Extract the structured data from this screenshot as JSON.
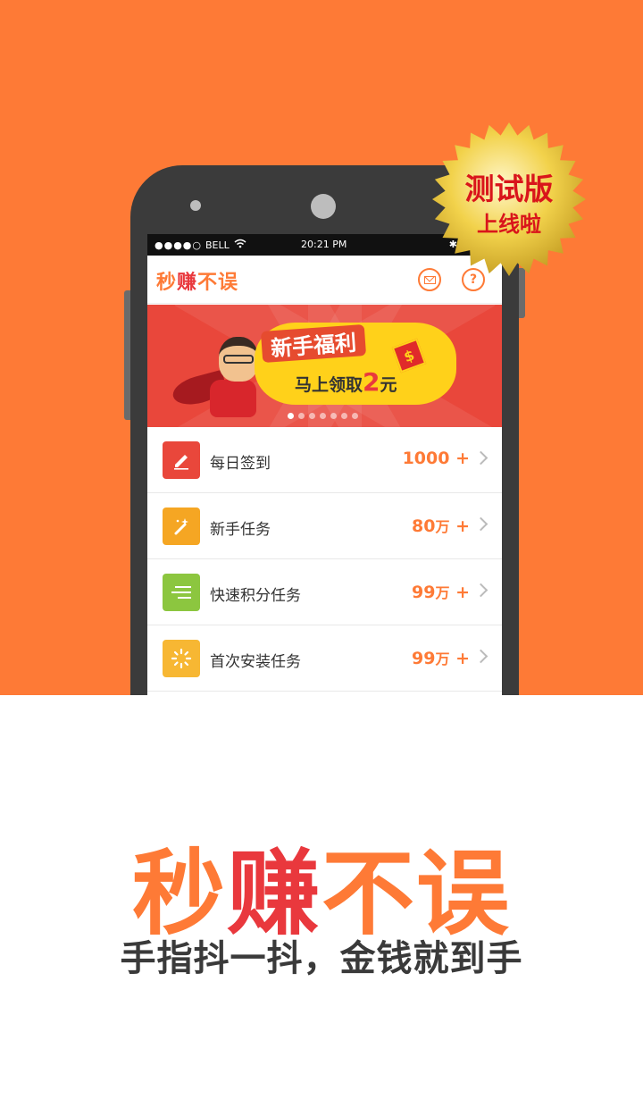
{
  "status_bar": {
    "signal": "●●●●○",
    "carrier": "BELL",
    "time": "20:21 PM",
    "bluetooth": "✱"
  },
  "app": {
    "title_part1": "秒",
    "title_part2": "赚",
    "title_part3": "不误"
  },
  "header": {
    "message_icon": "envelope-icon",
    "help_label": "?"
  },
  "banner": {
    "title": "新手福利",
    "subtitle_pre": "马上领取",
    "amount": "2",
    "subtitle_post": "元",
    "packet_symbol": "$",
    "slide_count": 7,
    "active_slide": 1
  },
  "tasks": [
    {
      "label": "每日签到",
      "value": "1000",
      "unit": "",
      "suffix": "+",
      "color": "#e9473b",
      "icon": "pencil-icon"
    },
    {
      "label": "新手任务",
      "value": "80",
      "unit": "万",
      "suffix": "+",
      "color": "#f5a623",
      "icon": "magic-wand-icon"
    },
    {
      "label": "快速积分任务",
      "value": "99",
      "unit": "万",
      "suffix": "+",
      "color": "#8cc63f",
      "icon": "fast-lines-icon"
    },
    {
      "label": "首次安装任务",
      "value": "99",
      "unit": "万",
      "suffix": "+",
      "color": "#f7b733",
      "icon": "loading-spinner-icon"
    }
  ],
  "badge": {
    "line1": "测试版",
    "line2": "上线啦"
  },
  "promo": {
    "brand_part1": "秒",
    "brand_part2": "赚",
    "brand_part3": "不误",
    "slogan": "手指抖一抖，金钱就到手"
  },
  "colors": {
    "brand_orange": "#fe7a36",
    "brand_red": "#e9383d",
    "badge_gold": "#f2d24b"
  }
}
